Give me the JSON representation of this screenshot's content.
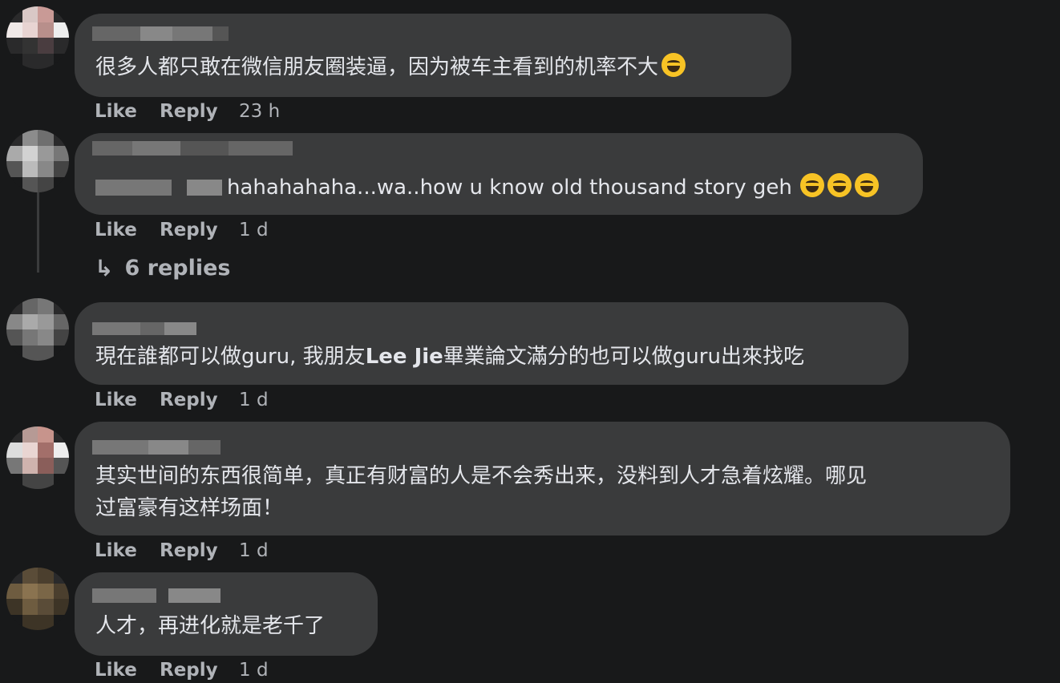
{
  "actions": {
    "like": "Like",
    "reply": "Reply"
  },
  "comments": [
    {
      "text": "很多人都只敢在微信朋友圈装逼，因为被车主看到的机率不大",
      "emoji": "laughing-tears-emoji",
      "time": "23 h"
    },
    {
      "mention": "",
      "text": "hahahahaha...wa..how u know old thousand story geh",
      "emoji": "grinning-sweat-emoji",
      "time": "1 d",
      "replies": "6 replies"
    },
    {
      "text_before": "現在誰都可以做guru, 我朋友",
      "text_bold": "Lee Jie",
      "text_after": "畢業論文滿分的也可以做guru出來找吃",
      "time": "1 d"
    },
    {
      "line1": "其实世间的东西很简单，真正有财富的人是不会秀出来，没料到人才急着炫耀。哪见",
      "line2": "过富豪有这样场面！",
      "time": "1 d"
    },
    {
      "text": "人才，再进化就是老千了",
      "time": "1 d"
    }
  ]
}
